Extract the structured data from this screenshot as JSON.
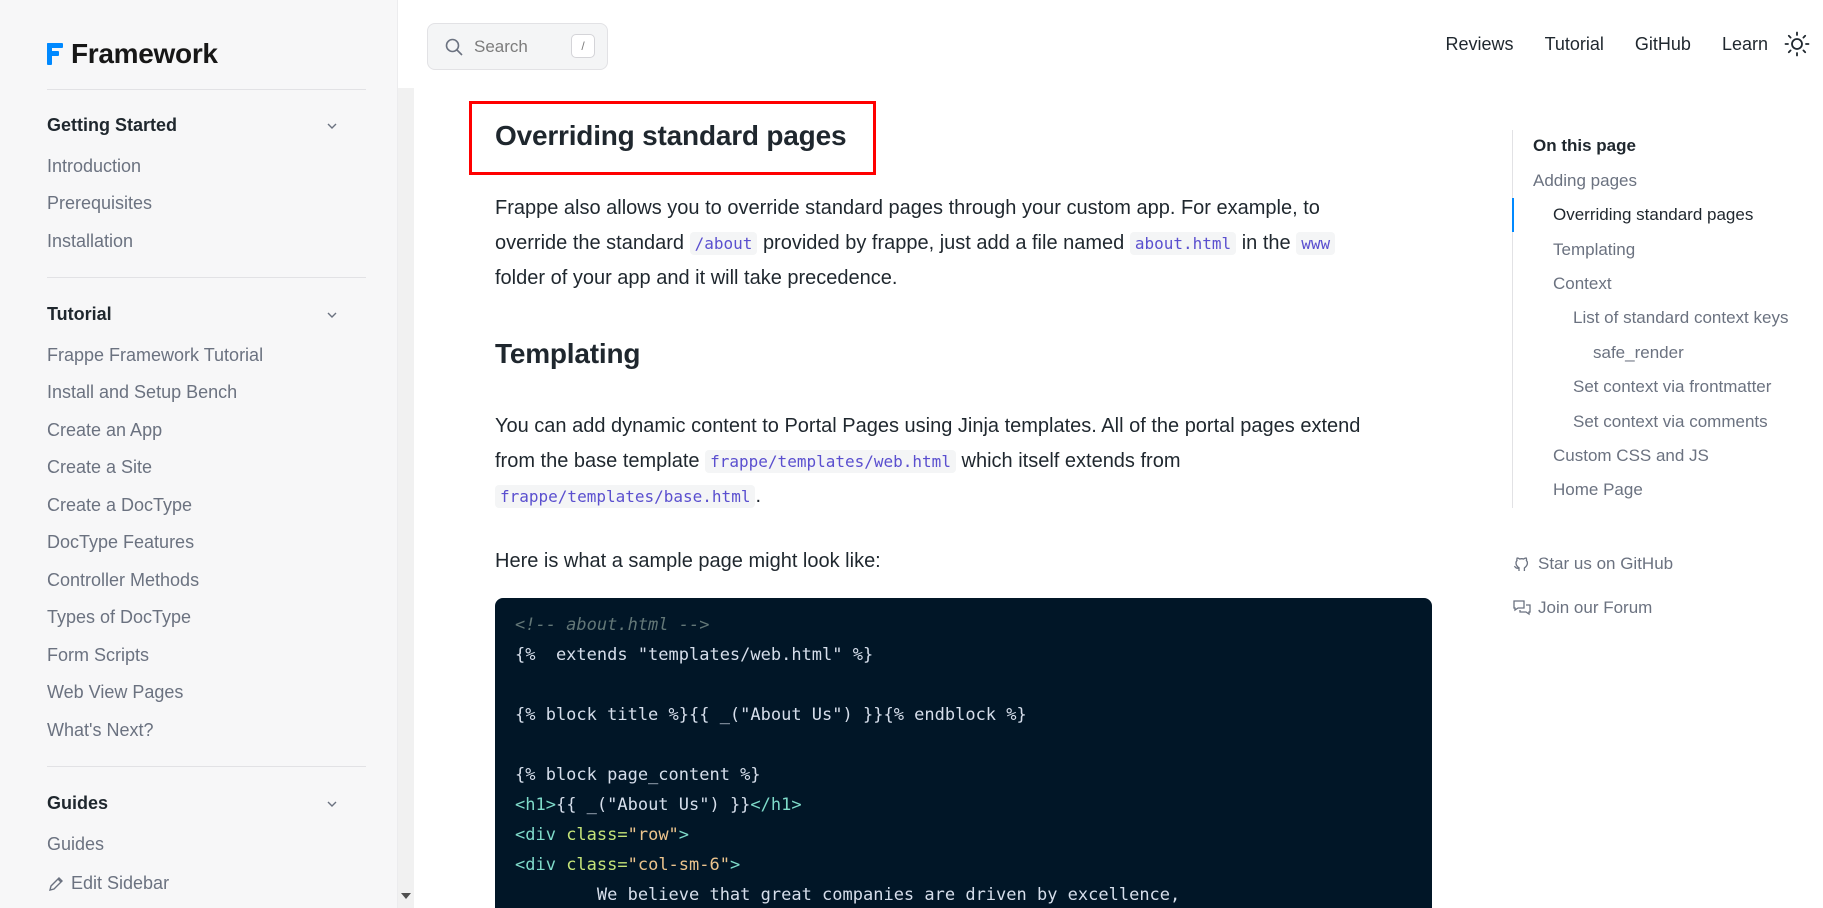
{
  "brand": {
    "name": "Framework",
    "accent": "#0089ff"
  },
  "sidebar": {
    "sections": [
      {
        "title": "Getting Started",
        "items": [
          "Introduction",
          "Prerequisites",
          "Installation"
        ]
      },
      {
        "title": "Tutorial",
        "items": [
          "Frappe Framework Tutorial",
          "Install and Setup Bench",
          "Create an App",
          "Create a Site",
          "Create a DocType",
          "DocType Features",
          "Controller Methods",
          "Types of DocType",
          "Form Scripts",
          "Web View Pages",
          "What's Next?"
        ]
      },
      {
        "title": "Guides",
        "items": [
          "Guides"
        ]
      }
    ],
    "edit_label": "Edit Sidebar"
  },
  "header": {
    "search_placeholder": "Search",
    "search_shortcut": "/",
    "nav": [
      "Reviews",
      "Tutorial",
      "GitHub",
      "Learn"
    ]
  },
  "content": {
    "section1": {
      "heading": "Overriding standard pages",
      "p1_a": "Frappe also allows you to override standard pages through your custom app. For example, to",
      "p1_b": "override the standard",
      "p1_code1": "/about",
      "p1_c": "provided by frappe, just add a file named",
      "p1_code2": "about.html",
      "p1_d": "in the",
      "p1_code3": "www",
      "p1_e": "folder of your app and it will take precedence."
    },
    "section2": {
      "heading": "Templating",
      "p1_a": "You can add dynamic content to Portal Pages using Jinja templates. All of the portal pages extend",
      "p1_b": "from the base template",
      "p1_code1": "frappe/templates/web.html",
      "p1_c": "which itself extends from",
      "p1_code2": "frappe/templates/base.html",
      "p1_d": ".",
      "p2": "Here is what a sample page might look like:"
    },
    "code": {
      "l1": "<!-- about.html -->",
      "l2": "{%  extends \"templates/web.html\" %}",
      "l4": "{% block title %}{{ _(\"About Us\") }}{% endblock %}",
      "l6": "{% block page_content %}",
      "l7_open": "<h1>",
      "l7_mid": "{{ _(\"About Us\") }}",
      "l7_close": "</h1>",
      "l8_tag": "<div ",
      "l8_attr": "class=",
      "l8_val": "\"row\"",
      "l8_end": ">",
      "l9_tag": "<div ",
      "l9_attr": "class=",
      "l9_val": "\"col-sm-6\"",
      "l9_end": ">",
      "l10": "        We believe that great companies are driven by excellence,"
    }
  },
  "toc": {
    "title": "On this page",
    "items": [
      {
        "label": "Adding pages"
      },
      {
        "label": "Overriding standard pages"
      },
      {
        "label": "Templating"
      },
      {
        "label": "Context"
      },
      {
        "label": "List of standard context keys"
      },
      {
        "label": "safe_render"
      },
      {
        "label": "Set context via frontmatter"
      },
      {
        "label": "Set context via comments"
      },
      {
        "label": "Custom CSS and JS"
      },
      {
        "label": "Home Page"
      }
    ],
    "active": "Overriding standard pages"
  },
  "community": {
    "github": "Star us on GitHub",
    "forum": "Join our Forum"
  }
}
